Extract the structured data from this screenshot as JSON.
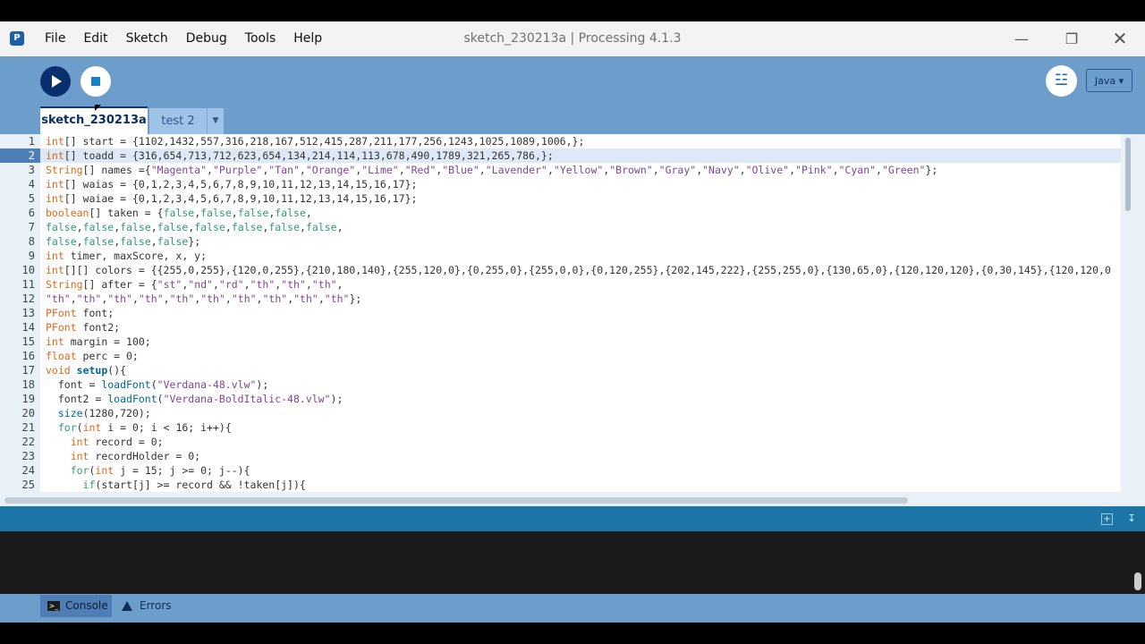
{
  "window": {
    "title": "sketch_230213a | Processing 4.1.3",
    "app_icon": "processing-logo",
    "controls": {
      "minimize": "minimize-icon",
      "maximize": "maximize-icon",
      "close": "close-icon"
    }
  },
  "menu": [
    "File",
    "Edit",
    "Sketch",
    "Debug",
    "Tools",
    "Help"
  ],
  "toolbar": {
    "run_icon": "play-icon",
    "stop_icon": "stop-icon",
    "debugger_icon": "debugger-icon",
    "mode_label": "Java ▾"
  },
  "tabs": [
    {
      "label": "sketch_230213a",
      "active": true
    },
    {
      "label": "test 2",
      "active": false
    }
  ],
  "tab_menu_icon": "▼",
  "editor": {
    "current_line": 2,
    "lines": [
      "int[] start = {1102,1432,557,316,218,167,512,415,287,211,177,256,1243,1025,1089,1006,};",
      "int[] toadd = {316,654,713,712,623,654,134,214,114,113,678,490,1789,321,265,786,};",
      "String[] names ={\"Magenta\",\"Purple\",\"Tan\",\"Orange\",\"Lime\",\"Red\",\"Blue\",\"Lavender\",\"Yellow\",\"Brown\",\"Gray\",\"Navy\",\"Olive\",\"Pink\",\"Cyan\",\"Green\"};",
      "int[] waias = {0,1,2,3,4,5,6,7,8,9,10,11,12,13,14,15,16,17};",
      "int[] waiae = {0,1,2,3,4,5,6,7,8,9,10,11,12,13,14,15,16,17};",
      "boolean[] taken = {false,false,false,false,",
      "false,false,false,false,false,false,false,false,",
      "false,false,false,false};",
      "int timer, maxScore, x, y;",
      "int[][] colors = {{255,0,255},{120,0,255},{210,180,140},{255,120,0},{0,255,0},{255,0,0},{0,120,255},{202,145,222},{255,255,0},{130,65,0},{120,120,120},{0,30,145},{120,120,0",
      "String[] after = {\"st\",\"nd\",\"rd\",\"th\",\"th\",\"th\",",
      "\"th\",\"th\",\"th\",\"th\",\"th\",\"th\",\"th\",\"th\",\"th\",\"th\"};",
      "PFont font;",
      "PFont font2;",
      "int margin = 100;",
      "float perc = 0;",
      "void setup(){",
      "  font = loadFont(\"Verdana-48.vlw\");",
      "  font2 = loadFont(\"Verdana-BoldItalic-48.vlw\");",
      "  size(1280,720);",
      "  for(int i = 0; i < 16; i++){",
      "    int record = 0;",
      "    int recordHolder = 0;",
      "    for(int j = 15; j >= 0; j--){",
      "      if(start[j] >= record && !taken[j]){"
    ]
  },
  "console_icons": {
    "add": "add-console-icon",
    "collapse": "collapse-console-icon"
  },
  "footer": {
    "console_label": "Console",
    "console_icon": "terminal-icon",
    "errors_label": "Errors",
    "errors_icon": "warning-icon"
  },
  "colors": {
    "toolbar_bg": "#6d9dcb",
    "run_button": "#0a2f6e",
    "status_bar": "#1e75a8",
    "console_bg": "#1b1b1b",
    "keyword": "#33997e",
    "type": "#e2661a",
    "function": "#006699",
    "string": "#7d4793"
  }
}
